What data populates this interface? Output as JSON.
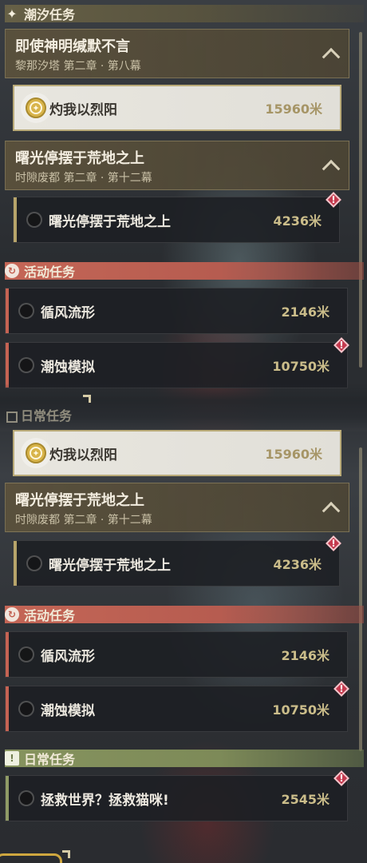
{
  "colors": {
    "tidal_accent": "#b7a46a",
    "event_accent": "#c56353",
    "daily_accent": "#8f9b66",
    "warning": "#c43a4e",
    "distance_text": "#cbbd8a"
  },
  "sections": {
    "tidal": {
      "icon": "sparkle-icon",
      "label": "潮汐任务"
    },
    "event": {
      "icon": "refresh-icon",
      "label": "活动任务"
    },
    "daily": {
      "icon": "exclamation-icon",
      "label": "日常任务",
      "label_partial": "日常任务"
    }
  },
  "top": {
    "chapter1": {
      "title": "即使神明缄默不言",
      "subtitle": "黎那汐塔 第二章 · 第八幕"
    },
    "quest_sunrise": {
      "name": "灼我以烈阳",
      "distance": "15960米",
      "tracked": true
    },
    "chapter2": {
      "title": "曙光停摆于荒地之上",
      "subtitle": "时隙废都 第二章 · 第十二幕"
    },
    "quest_dawn": {
      "name": "曙光停摆于荒地之上",
      "distance": "4236米"
    },
    "quest_wind": {
      "name": "循风流形",
      "distance": "2146米"
    },
    "quest_erosion": {
      "name": "潮蚀模拟",
      "distance": "10750米"
    }
  },
  "bottom": {
    "quest_sunrise": {
      "name": "灼我以烈阳",
      "distance": "15960米",
      "tracked": true
    },
    "chapter2": {
      "title": "曙光停摆于荒地之上",
      "subtitle": "时隙废都 第二章 · 第十二幕"
    },
    "quest_dawn": {
      "name": "曙光停摆于荒地之上",
      "distance": "4236米"
    },
    "quest_wind": {
      "name": "循风流形",
      "distance": "2146米"
    },
    "quest_erosion": {
      "name": "潮蚀模拟",
      "distance": "10750米"
    },
    "quest_cat": {
      "name": "拯救世界？拯救猫咪!",
      "distance": "2545米"
    }
  },
  "warning_icon": "!"
}
